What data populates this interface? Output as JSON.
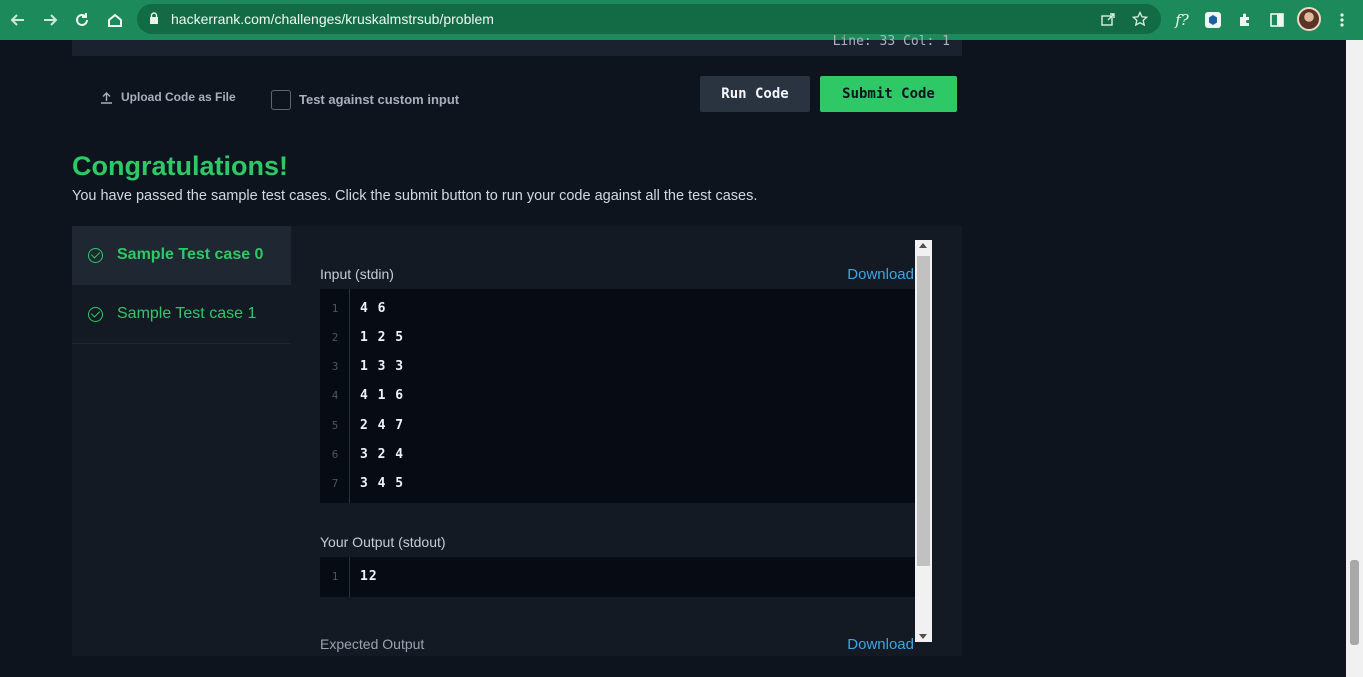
{
  "browser": {
    "url": "hackerrank.com/challenges/kruskalmstrsub/problem",
    "extension_label": "f?"
  },
  "editor": {
    "cut_off_text": "Line: 33 Col: 1"
  },
  "actions": {
    "upload_label": "Upload Code as File",
    "custom_input_label": "Test against custom input",
    "custom_input_checked": false,
    "run_label": "Run Code",
    "submit_label": "Submit Code"
  },
  "result": {
    "title": "Congratulations!",
    "message": "You have passed the sample test cases. Click the submit button to run your code against all the test cases."
  },
  "test_cases": [
    {
      "label": "Sample Test case 0",
      "status": "passed",
      "selected": true
    },
    {
      "label": "Sample Test case 1",
      "status": "passed",
      "selected": false
    }
  ],
  "detail": {
    "input_label": "Input (stdin)",
    "download_label": "Download",
    "input_lines": [
      {
        "n": "1",
        "text": "4 6"
      },
      {
        "n": "2",
        "text": "1 2 5"
      },
      {
        "n": "3",
        "text": "1 3 3"
      },
      {
        "n": "4",
        "text": "4 1 6"
      },
      {
        "n": "5",
        "text": "2 4 7"
      },
      {
        "n": "6",
        "text": "3 2 4"
      },
      {
        "n": "7",
        "text": "3 4 5"
      }
    ],
    "output_label": "Your Output (stdout)",
    "output_lines": [
      {
        "n": "1",
        "text": "12"
      }
    ],
    "expected_label": "Expected Output"
  },
  "colors": {
    "chrome": "#1d8a5c",
    "accent_green": "#2ec866",
    "link_blue": "#3ba7e8",
    "page_bg": "#0e141e"
  }
}
